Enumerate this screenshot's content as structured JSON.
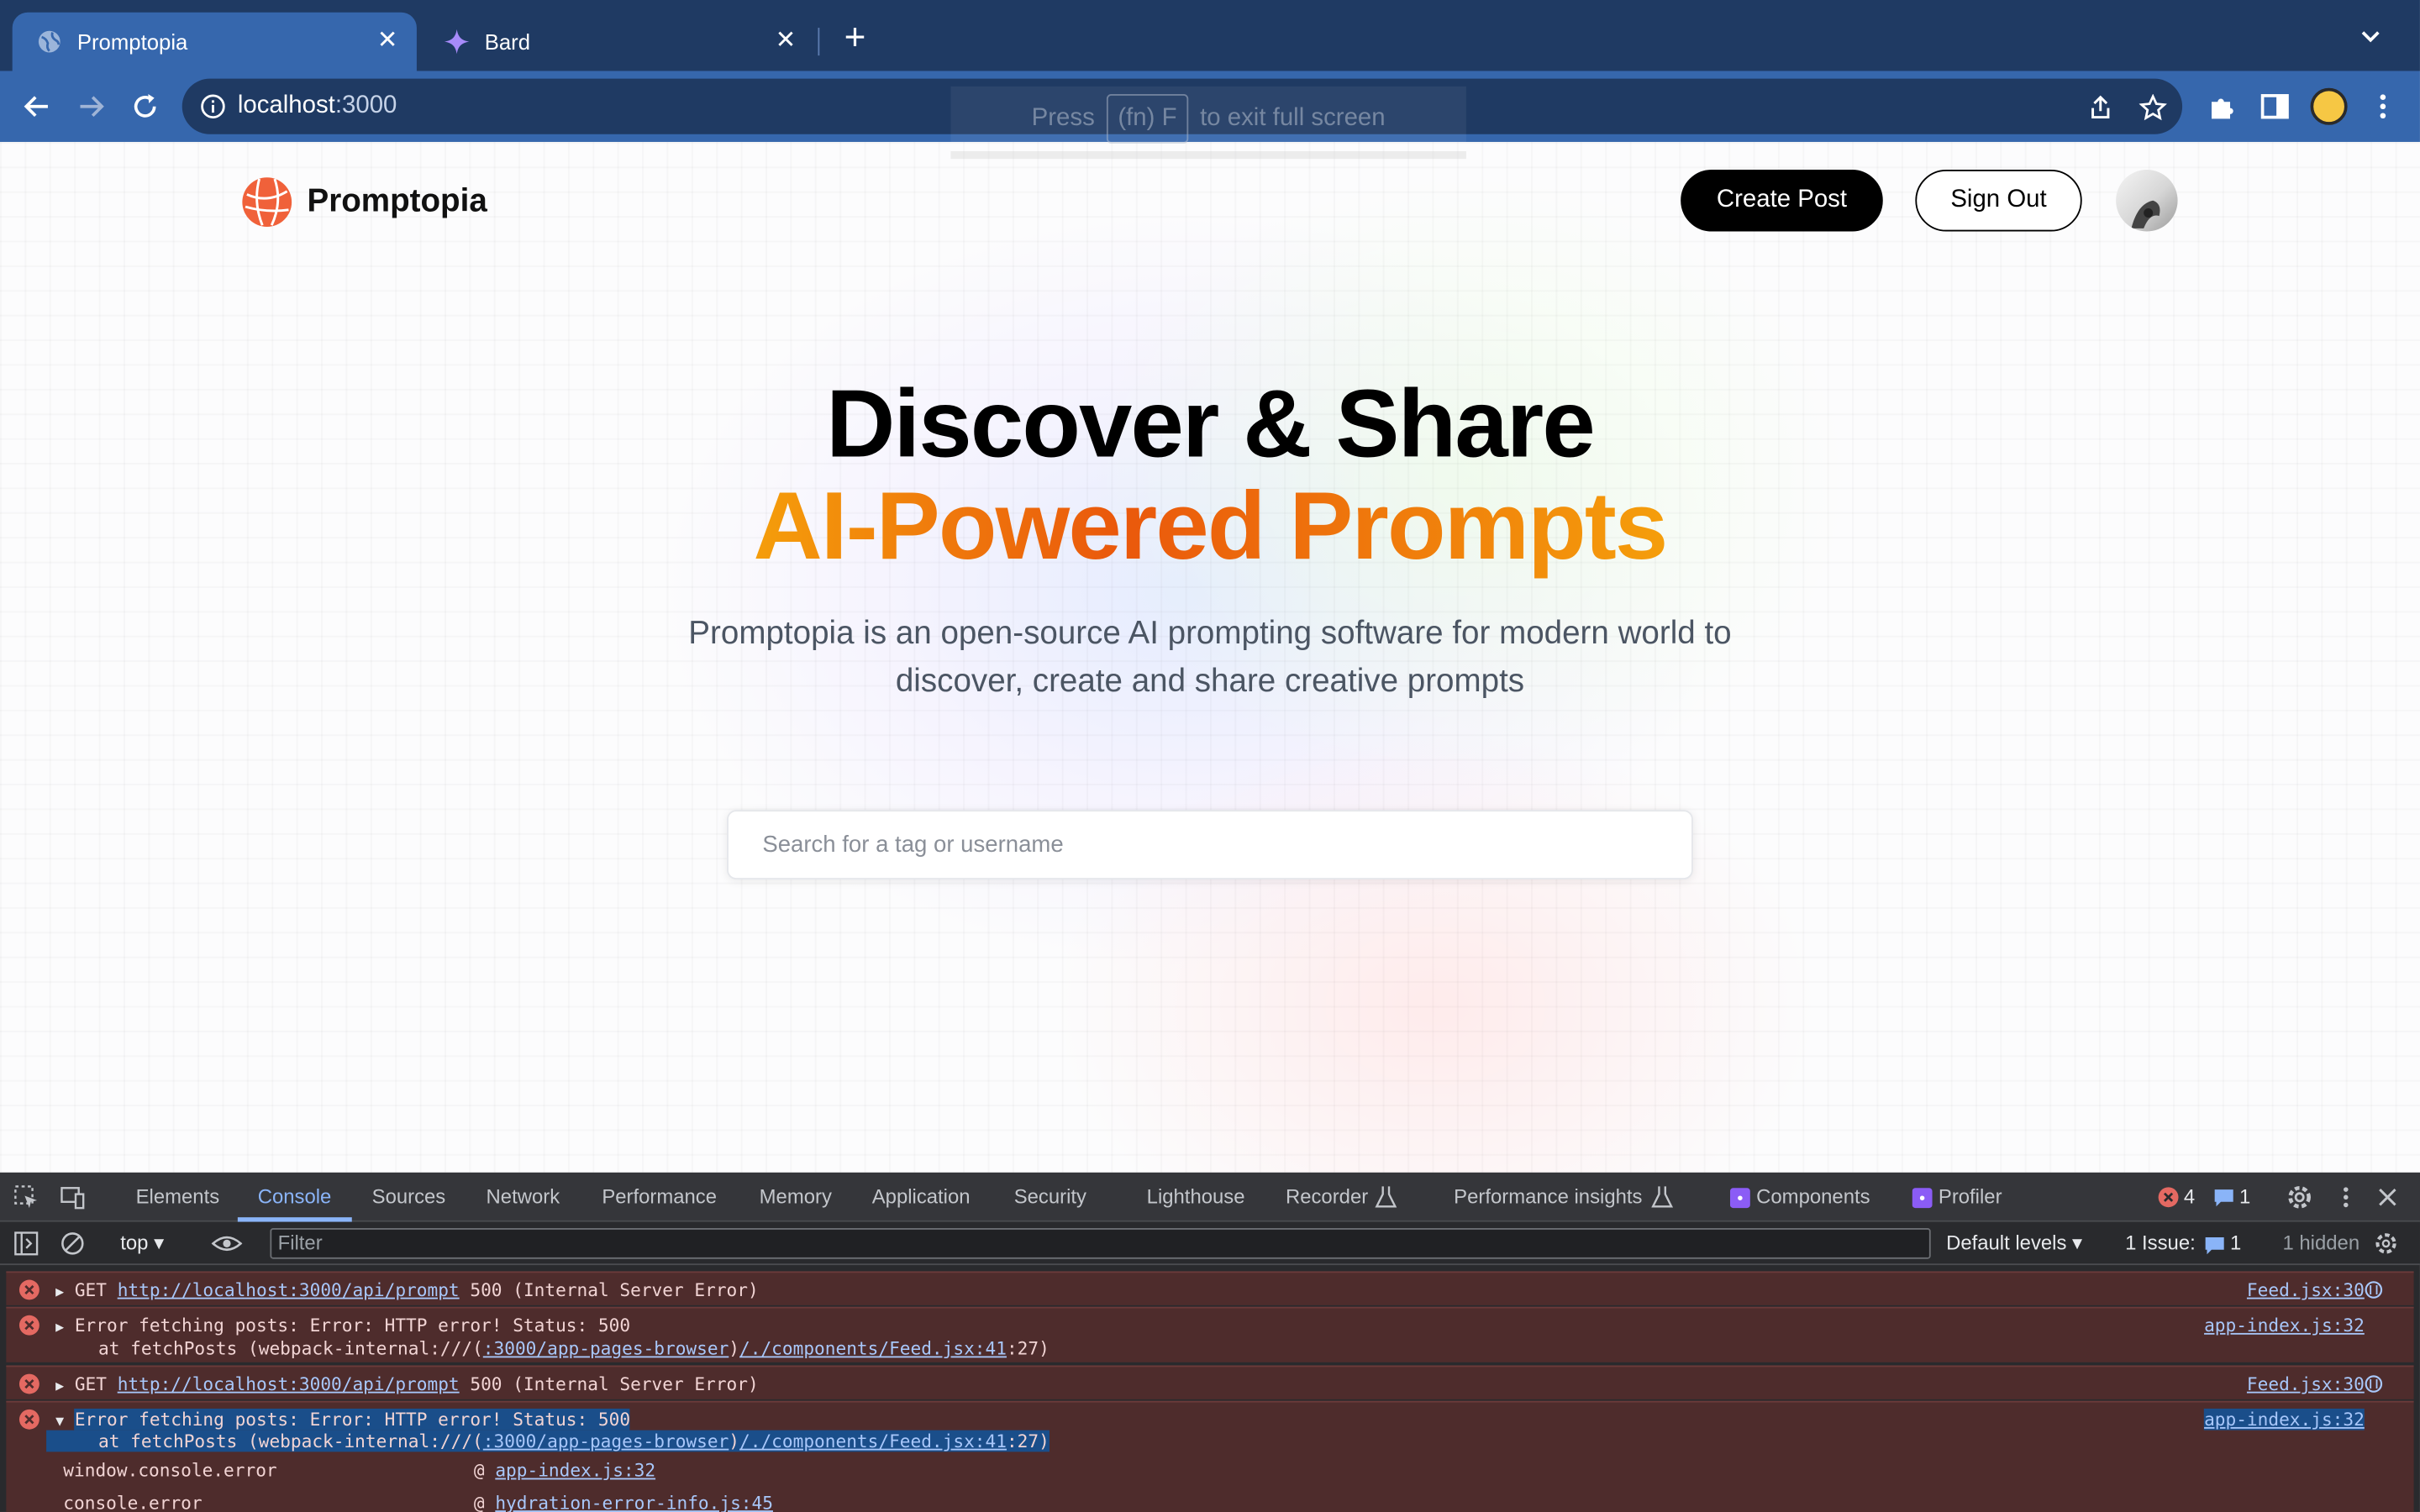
{
  "browser": {
    "tabs": [
      {
        "title": "Promptopia",
        "active": true,
        "icon": "globe-icon"
      },
      {
        "title": "Bard",
        "active": false,
        "icon": "bard-sparkle-icon"
      }
    ],
    "url_host": "localhost",
    "url_port": ":3000",
    "fullscreen_hint": {
      "press": "Press",
      "key": "(fn) F",
      "suffix": "to exit full screen"
    }
  },
  "nav": {
    "brand": "Promptopia",
    "create_post": "Create Post",
    "sign_out": "Sign Out"
  },
  "hero": {
    "line1": "Discover & Share",
    "line2": "AI-Powered Prompts",
    "description": "Promptopia is an open-source AI prompting software for modern world to discover, create and share creative prompts"
  },
  "search": {
    "placeholder": "Search for a tag or username"
  },
  "devtools": {
    "tabs": [
      "Elements",
      "Console",
      "Sources",
      "Network",
      "Performance",
      "Memory",
      "Application",
      "Security",
      "Lighthouse",
      "Recorder",
      "Performance insights",
      "Components",
      "Profiler"
    ],
    "active_tab": "Console",
    "error_count": "4",
    "message_count": "1",
    "context": "top",
    "filter_placeholder": "Filter",
    "levels": "Default levels",
    "issues_label": "1 Issue:",
    "issues_count": "1",
    "hidden": "1 hidden",
    "logs": [
      {
        "prefix": "GET ",
        "link": "http://localhost:3000/api/prompt",
        "suffix": " 500 (Internal Server Error)",
        "source": "Feed.jsx:30"
      },
      {
        "text": "Error fetching posts: Error: HTTP error! Status: 500",
        "stack_pre": "    at fetchPosts (webpack-internal:///(",
        "stack_link1": ":3000/app-pages-browser",
        "stack_mid": ")",
        "stack_link2": "/./components/Feed.jsx:41",
        "stack_post": ":27)",
        "source": "app-index.js:32"
      },
      {
        "prefix": "GET ",
        "link": "http://localhost:3000/api/prompt",
        "suffix": " 500 (Internal Server Error)",
        "source": "Feed.jsx:30"
      },
      {
        "text": "Error fetching posts: Error: HTTP error! Status: 500",
        "stack_pre": "    at fetchPosts (webpack-internal:///(",
        "stack_link1": ":3000/app-pages-browser",
        "stack_mid": ")",
        "stack_link2": "/./components/Feed.jsx:41",
        "stack_post": ":27)",
        "source": "app-index.js:32"
      }
    ],
    "trace": [
      {
        "fn": "window.console.error",
        "at": "@ ",
        "file": "app-index.js:32"
      },
      {
        "fn": "console.error",
        "at": "@ ",
        "file": "hydration-error-info.js:45"
      }
    ]
  }
}
